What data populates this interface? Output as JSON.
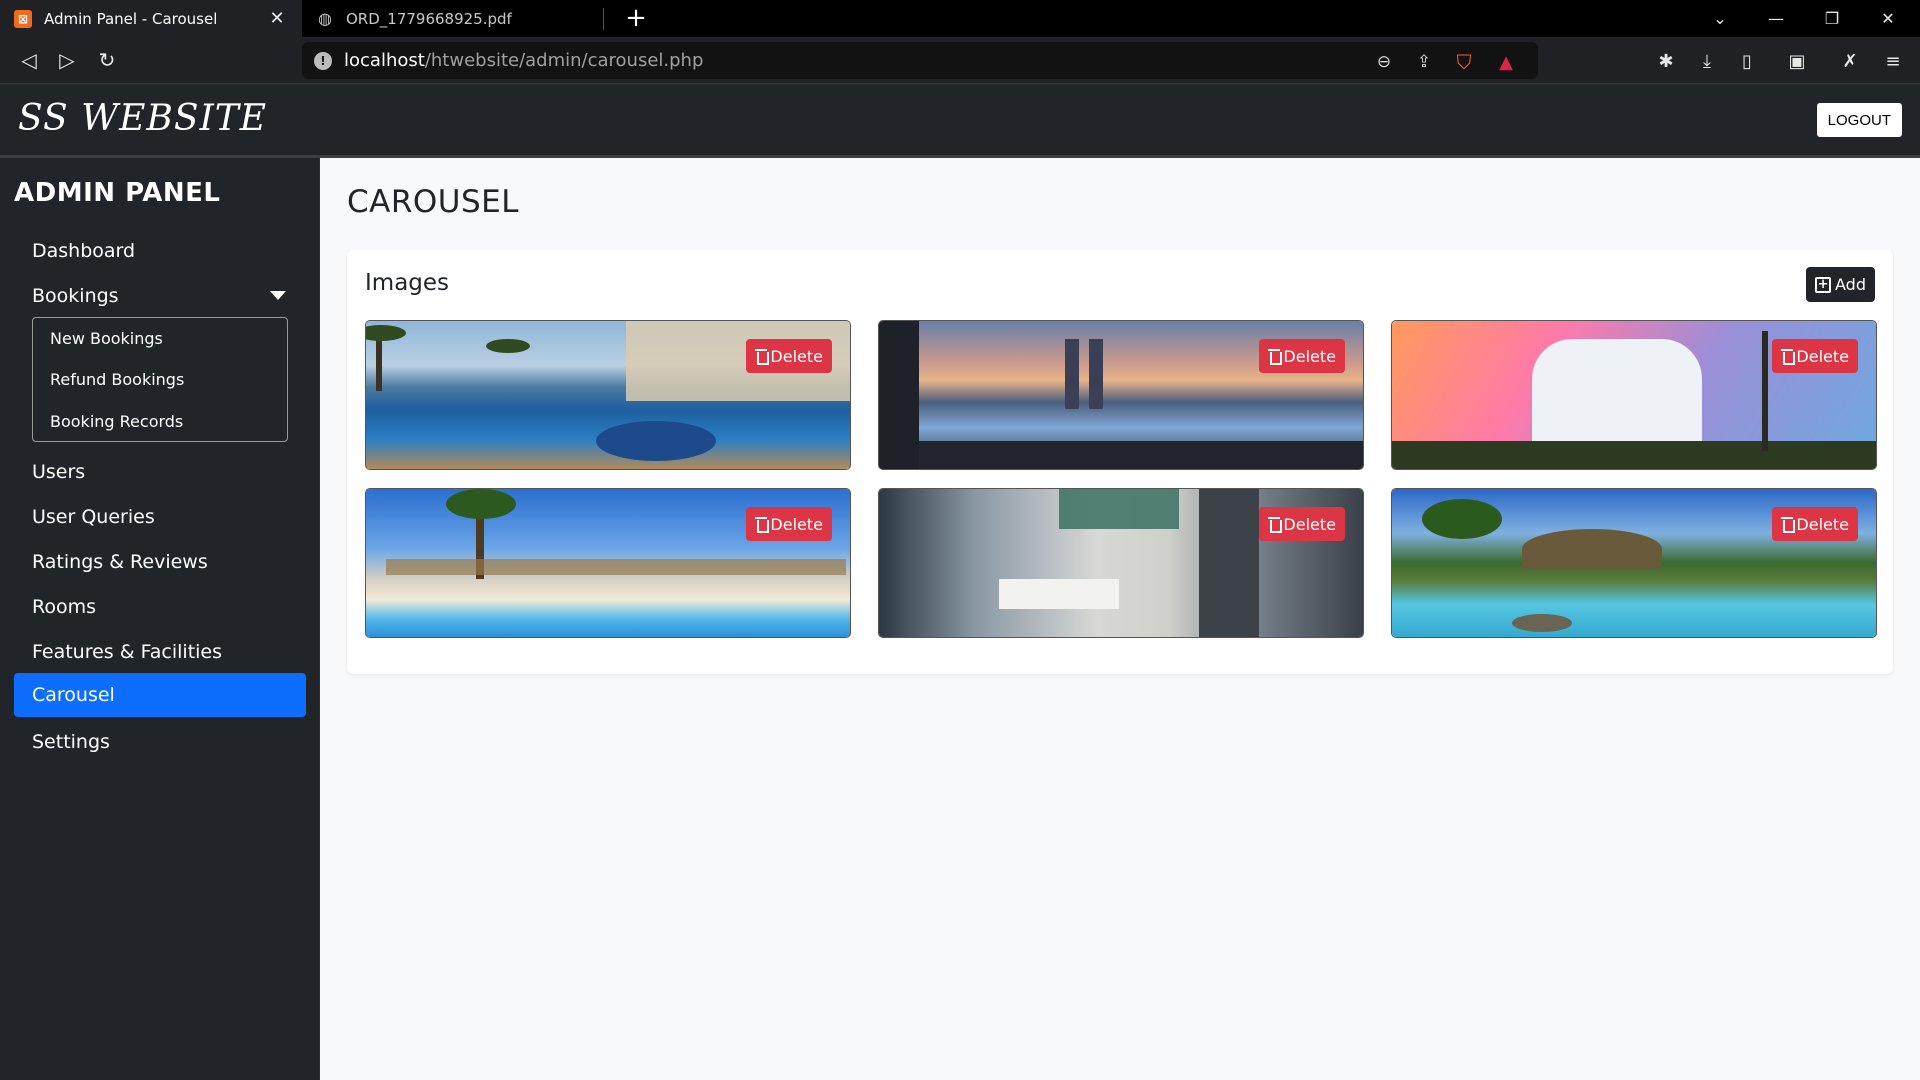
{
  "browser": {
    "tabs": [
      {
        "title": "Admin Panel - Carousel",
        "favicon": "xampp-icon",
        "active": true
      },
      {
        "title": "ORD_1779668925.pdf",
        "favicon": "globe-icon",
        "active": false
      }
    ],
    "url_host": "localhost",
    "url_path": "/htwebsite/admin/carousel.php"
  },
  "header": {
    "brand": "SS WEBSITE",
    "logout_label": "LOGOUT"
  },
  "sidebar": {
    "panel_title": "ADMIN PANEL",
    "items": [
      {
        "label": "Dashboard"
      },
      {
        "label": "Bookings"
      },
      {
        "label": "Users"
      },
      {
        "label": "User Queries"
      },
      {
        "label": "Ratings & Reviews"
      },
      {
        "label": "Rooms"
      },
      {
        "label": "Features & Facilities"
      },
      {
        "label": "Carousel"
      },
      {
        "label": "Settings"
      }
    ],
    "booking_subitems": [
      {
        "label": "New Bookings"
      },
      {
        "label": "Refund Bookings"
      },
      {
        "label": "Booking Records"
      }
    ],
    "active_item": "Carousel"
  },
  "main": {
    "page_title": "CAROUSEL",
    "card_title": "Images",
    "add_label": "Add",
    "delete_label": "Delete",
    "images": [
      {
        "scene": "resort-pool-beach"
      },
      {
        "scene": "infinity-pool-city-skyline"
      },
      {
        "scene": "hotel-tower-sunset"
      },
      {
        "scene": "beach-pool-umbrellas"
      },
      {
        "scene": "hotel-lobby-interior"
      },
      {
        "scene": "tropical-resort-pool"
      }
    ]
  },
  "colors": {
    "dark": "#212529",
    "primary": "#0d6efd",
    "danger": "#dc3545",
    "background": "#f8f9fa"
  }
}
